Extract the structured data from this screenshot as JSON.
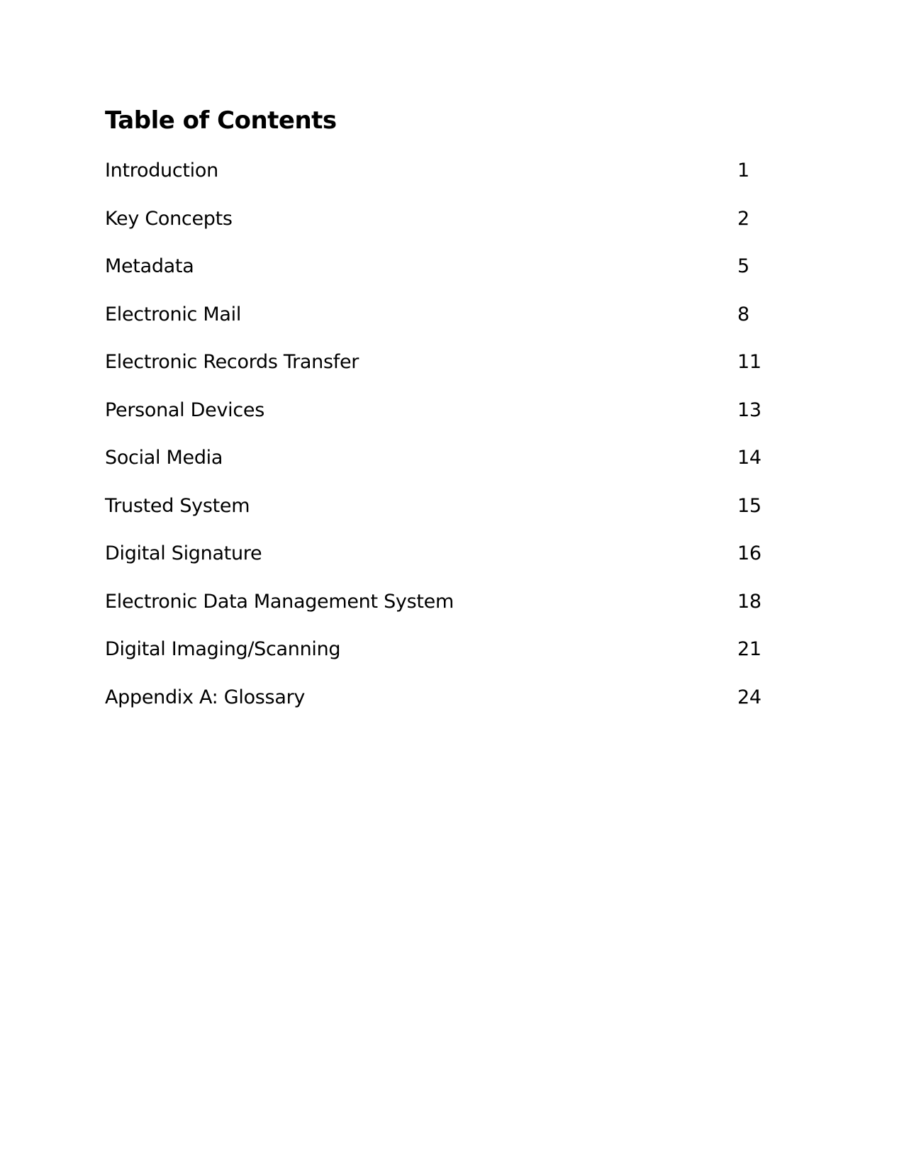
{
  "document": {
    "title": "Table of Contents",
    "entries": [
      {
        "label": "Introduction",
        "page": "1"
      },
      {
        "label": "Key Concepts",
        "page": "2"
      },
      {
        "label": "Metadata",
        "page": "5"
      },
      {
        "label": "Electronic Mail",
        "page": "8"
      },
      {
        "label": "Electronic Records Transfer",
        "page": "11"
      },
      {
        "label": "Personal Devices",
        "page": "13"
      },
      {
        "label": "Social Media",
        "page": "14"
      },
      {
        "label": "Trusted System",
        "page": "15"
      },
      {
        "label": "Digital Signature",
        "page": "16"
      },
      {
        "label": "Electronic Data Management System",
        "page": "18"
      },
      {
        "label": "Digital Imaging/Scanning",
        "page": "21"
      },
      {
        "label": "Appendix A: Glossary",
        "page": "24"
      }
    ]
  }
}
